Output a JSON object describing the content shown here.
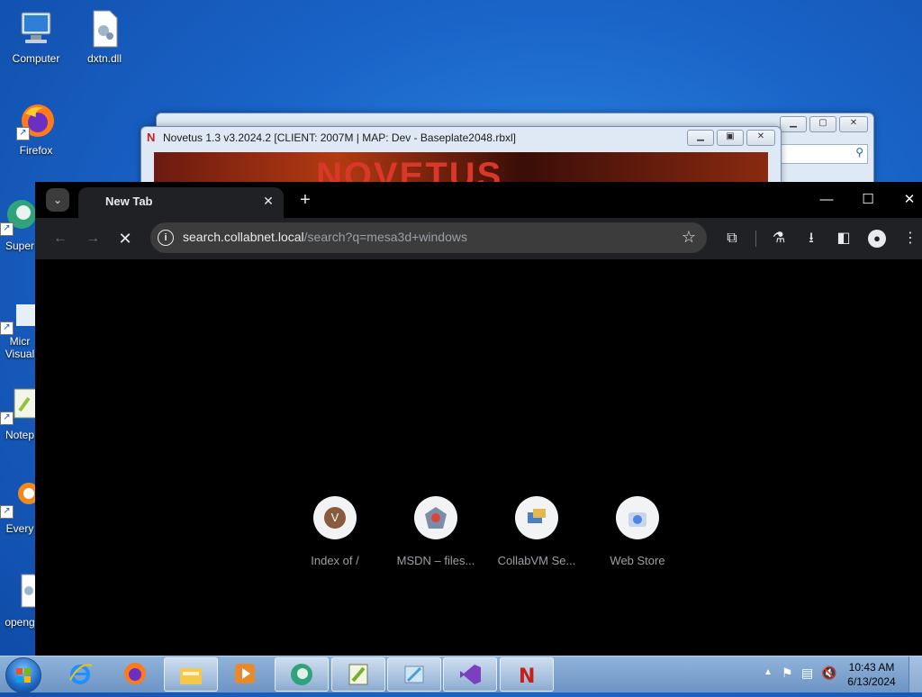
{
  "desktop": {
    "icons": [
      {
        "label": "Computer"
      },
      {
        "label": "dxtn.dll"
      },
      {
        "label": "Firefox"
      },
      {
        "label": "Super"
      },
      {
        "label": "Micr\nVisual"
      },
      {
        "label": "Notep"
      },
      {
        "label": "Every"
      },
      {
        "label": "openg"
      }
    ]
  },
  "novetus_window": {
    "title": "Novetus 1.3 v3.2024.2 [CLIENT: 2007M | MAP: Dev - Baseplate2048.rbxl]",
    "banner_text": "NOVETUS"
  },
  "browser": {
    "tab_title": "New Tab",
    "address": {
      "host": "search.collabnet.local",
      "path": "/search?q=mesa3d+windows"
    },
    "shortcuts": [
      {
        "label": "Index of /",
        "icon": "letter-v",
        "letter": "V",
        "color": "#8a5a3c"
      },
      {
        "label": "MSDN – files...",
        "icon": "msdn-icon"
      },
      {
        "label": "CollabVM Se...",
        "icon": "collabvm-icon"
      },
      {
        "label": "Web Store",
        "icon": "web-store-icon"
      }
    ]
  },
  "taskbar": {
    "items": [
      "internet-explorer",
      "firefox",
      "file-explorer",
      "media-player",
      "supertuxkart",
      "notepad-plus",
      "paint",
      "visual-studio",
      "novetus"
    ],
    "clock": {
      "time": "10:43 AM",
      "date": "6/13/2024"
    }
  },
  "colors": {
    "accent": "#8ab4f8",
    "browser_bg": "#000000",
    "toolbar_bg": "#202124"
  }
}
